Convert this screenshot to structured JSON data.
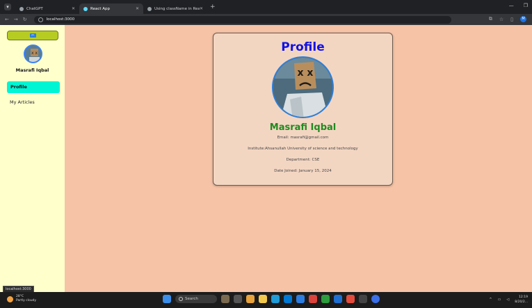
{
  "browser": {
    "tabs": [
      {
        "label": "ChatGPT",
        "active": false
      },
      {
        "label": "React App",
        "active": true
      },
      {
        "label": "Using className in React",
        "active": false
      }
    ],
    "url": "localhost:3000"
  },
  "sidebar": {
    "user_name": "Masrafi Iqbal",
    "nav": [
      {
        "label": "Profile",
        "active": true
      },
      {
        "label": "My Articles",
        "active": false
      }
    ]
  },
  "profile": {
    "title": "Profile",
    "name": "Masrafi Iqbal",
    "email": "Email: masrafi@gmail.com",
    "institute": "Institute:Ahsanullah University of science and technology",
    "department": "Department: CSE",
    "joined": "Date Joined: January 15, 2024"
  },
  "status_url": "localhost:3000",
  "taskbar": {
    "weather_temp": "28°C",
    "weather_desc": "Partly cloudy",
    "search": "Search",
    "time": "12:19",
    "date": "8/20/2..."
  },
  "colors": {
    "page_bg": "#f6c3a6",
    "sidebar_bg": "#ffffcc",
    "title": "#1212e6",
    "name": "#1f8b1f",
    "active_nav": "#00f5d4",
    "back_button": "#b6cc23"
  }
}
